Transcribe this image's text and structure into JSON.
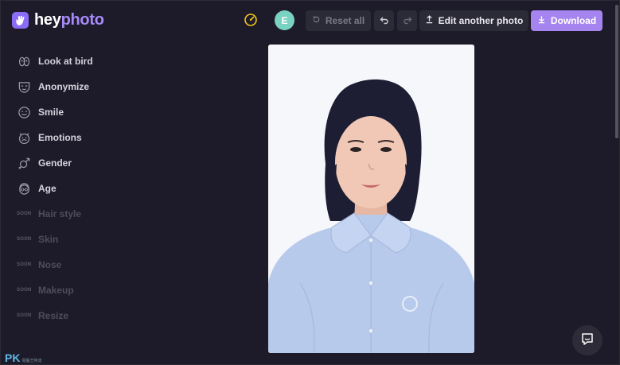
{
  "app": {
    "logo_text_a": "hey",
    "logo_text_b": "photo",
    "brand_color": "#a78bfa"
  },
  "header": {
    "avatar_initial": "E",
    "reset_label": "Reset all",
    "edit_label": "Edit another photo",
    "download_label": "Download",
    "icons": [
      "speedometer-icon",
      "reset-icon",
      "undo-icon",
      "redo-icon",
      "upload-icon",
      "download-icon"
    ]
  },
  "sidebar": {
    "items": [
      {
        "label": "Look at bird",
        "icon": "bird-eyes-icon"
      },
      {
        "label": "Anonymize",
        "icon": "mask-icon"
      },
      {
        "label": "Smile",
        "icon": "smile-icon"
      },
      {
        "label": "Emotions",
        "icon": "emotions-icon"
      },
      {
        "label": "Gender",
        "icon": "gender-icon"
      },
      {
        "label": "Age",
        "icon": "age-icon"
      }
    ],
    "soon_tag": "SOON",
    "soon_items": [
      {
        "label": "Hair style"
      },
      {
        "label": "Skin"
      },
      {
        "label": "Nose"
      },
      {
        "label": "Makeup"
      },
      {
        "label": "Resize"
      }
    ]
  },
  "watermark": {
    "big": "PK",
    "small": "電腦王阿達"
  }
}
